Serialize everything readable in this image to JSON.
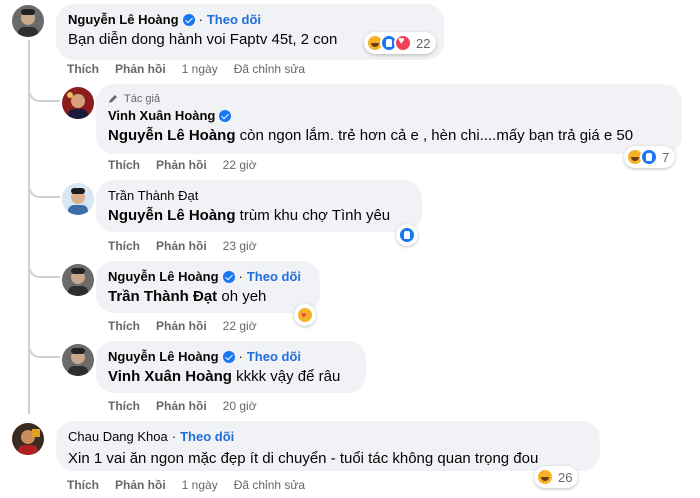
{
  "comments": [
    {
      "author": "Nguyễn Lê Hoàng",
      "follow_label": "Theo dõi",
      "text": "Bạn diễn dong hành voi Faptv 45t, 2 con",
      "actions": {
        "like": "Thích",
        "reply": "Phản hồi",
        "time": "1 ngày",
        "edited": "Đã chỉnh sửa"
      },
      "reaction_count": "22",
      "reaction_icons": [
        "haha-icon",
        "like-icon",
        "love-icon"
      ]
    },
    {
      "author_badge": "Tác giả",
      "author": "Vinh Xuân Hoàng",
      "mention": "Nguyễn Lê Hoàng",
      "text": " còn ngon lắm. trẻ hơn cả e , hèn chi....mấy bạn trả giá e 50",
      "actions": {
        "like": "Thích",
        "reply": "Phản hồi",
        "time": "22 giờ"
      },
      "reaction_count": "7",
      "reaction_icons": [
        "haha-icon",
        "like-icon"
      ]
    },
    {
      "author": "Trần Thành Đạt",
      "mention": "Nguyễn Lê Hoàng",
      "text": " trùm khu chợ Tình yêu",
      "actions": {
        "like": "Thích",
        "reply": "Phản hồi",
        "time": "23 giờ"
      },
      "reaction_icons": [
        "like-icon"
      ]
    },
    {
      "author": "Nguyễn Lê Hoàng",
      "follow_label": "Theo dõi",
      "mention": "Trần Thành Đạt",
      "text": " oh yeh",
      "actions": {
        "like": "Thích",
        "reply": "Phản hồi",
        "time": "22 giờ"
      },
      "reaction_icons": [
        "care-icon"
      ]
    },
    {
      "author": "Nguyễn Lê Hoàng",
      "follow_label": "Theo dõi",
      "mention": "Vinh Xuân Hoàng",
      "text": " kkkk vậy để râu",
      "actions": {
        "like": "Thích",
        "reply": "Phản hồi",
        "time": "20 giờ"
      }
    },
    {
      "author": "Chau Dang Khoa",
      "follow_label": "Theo dõi",
      "text": "Xin 1 vai ăn ngon mặc đẹp ít di chuyển - tuổi tác không quan trọng đou",
      "actions": {
        "like": "Thích",
        "reply": "Phản hồi",
        "time": "1 ngày",
        "edited": "Đã chỉnh sửa"
      },
      "reaction_count": "26",
      "reaction_icons": [
        "haha-icon"
      ]
    }
  ],
  "colors": {
    "bubble": "#f0f2f5",
    "follow": "#216fdb",
    "meta": "#65676b",
    "verified": "#1877f2"
  }
}
